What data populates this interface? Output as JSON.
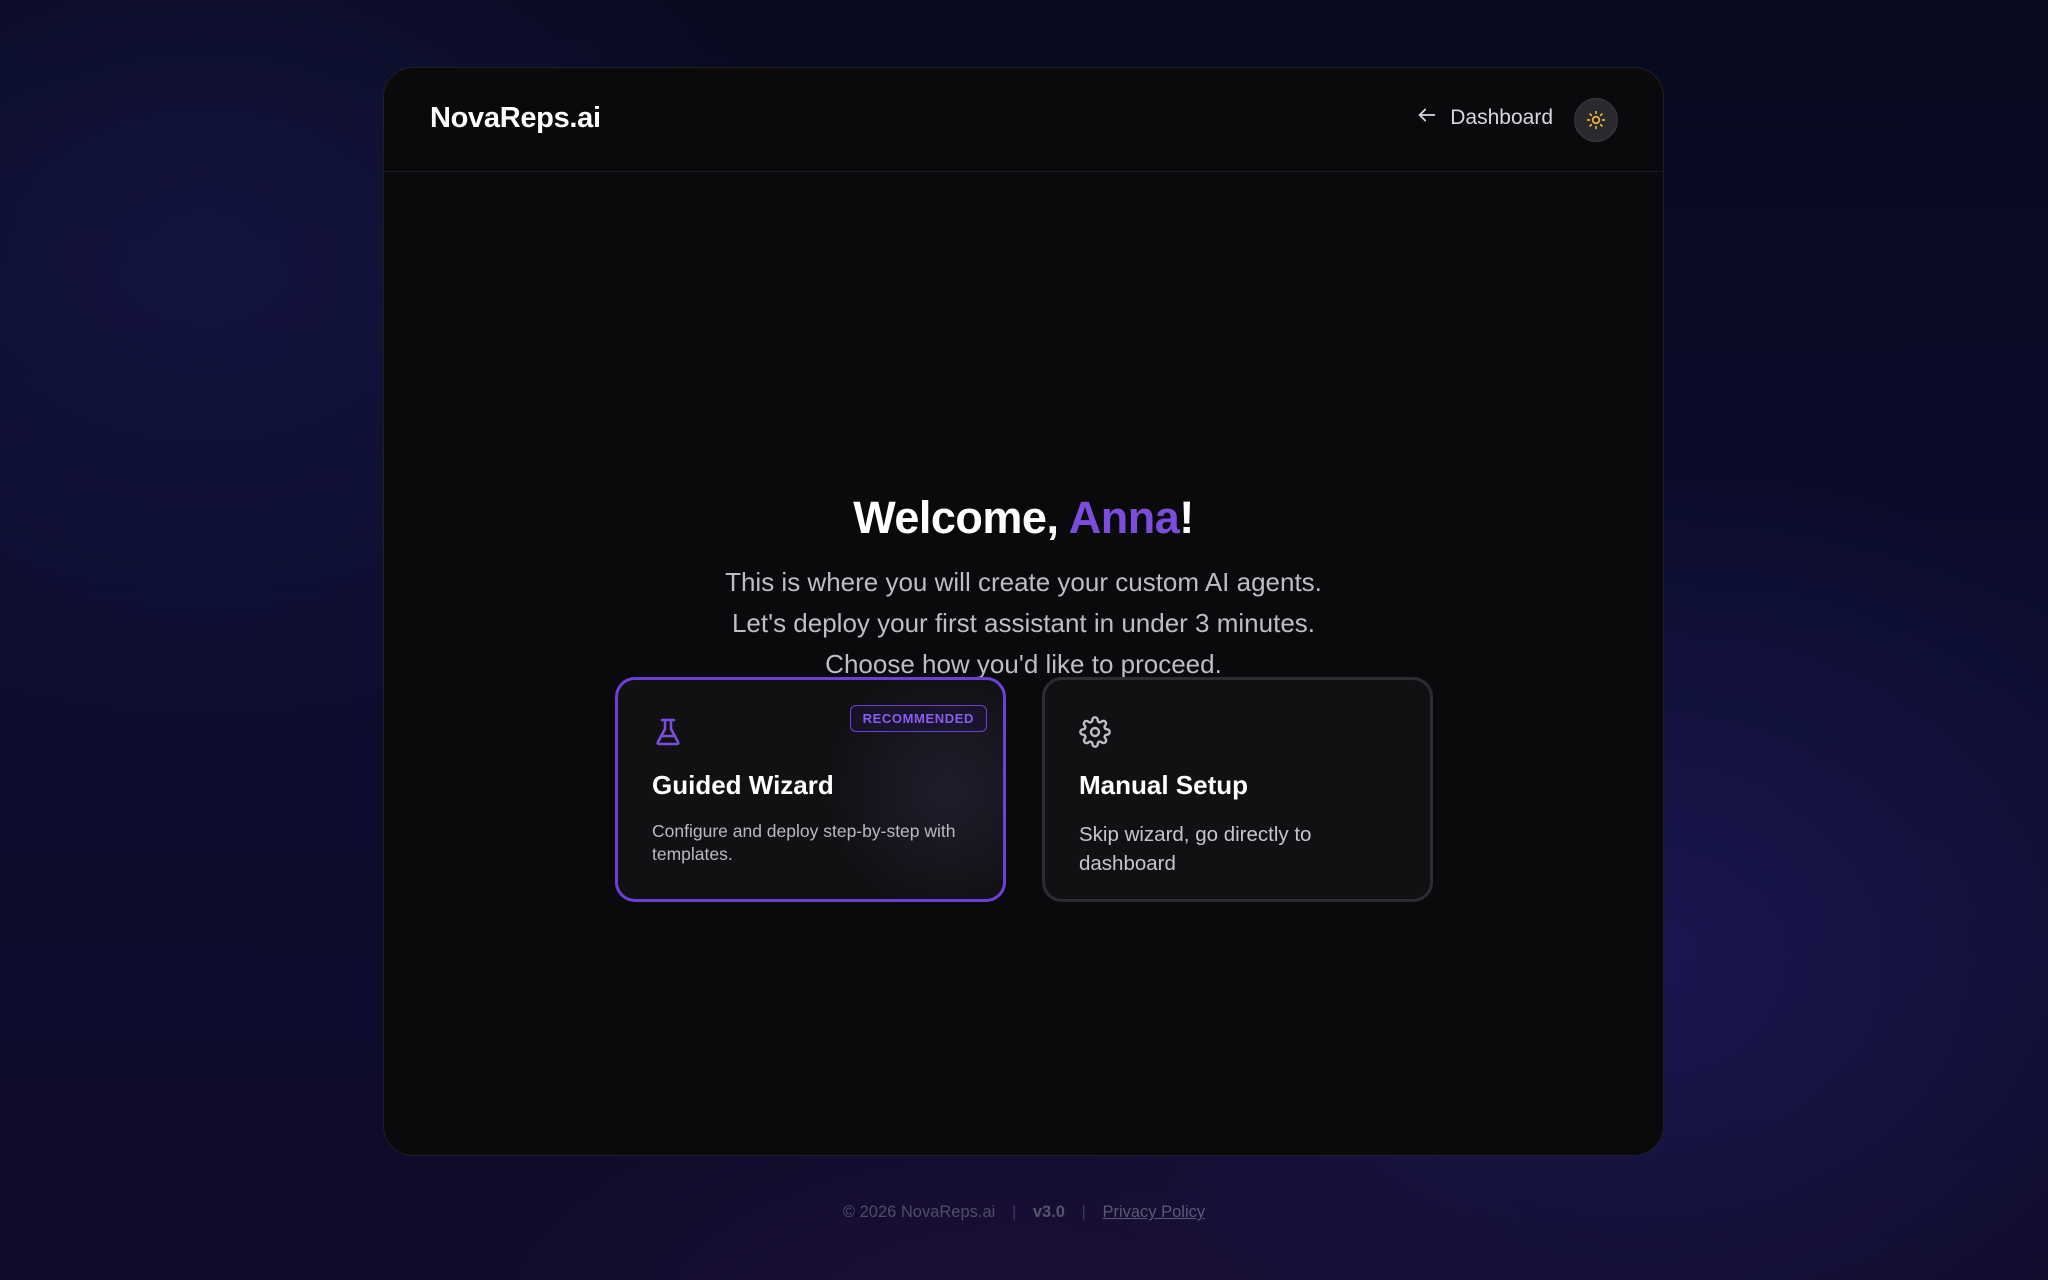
{
  "header": {
    "brand": "NovaReps.ai",
    "dashboard_label": "Dashboard",
    "back_icon": "arrow-left-icon",
    "theme_icon": "sun-icon"
  },
  "hero": {
    "greeting": "Welcome, ",
    "user_name": "Anna",
    "exclamation": "!",
    "subtitle_lines": [
      "This is where you will create your custom AI agents.",
      "Let's deploy your first assistant in under 3 minutes.",
      "Choose how you'd like to proceed."
    ]
  },
  "options": [
    {
      "title": "Guided Wizard",
      "description": "Configure and deploy step-by-step with templates.",
      "badge": "RECOMMENDED",
      "icon": "flask-icon",
      "selected": true
    },
    {
      "title": "Manual Setup",
      "description": "Skip wizard, go directly to dashboard",
      "icon": "gear-icon",
      "selected": false
    }
  ],
  "footer": {
    "copyright": "© 2026 NovaReps.ai",
    "version": "v3.0",
    "privacy": "Privacy Policy"
  },
  "colors": {
    "accent": "#7c4ddb",
    "card_border_selected": "#6c3fd9",
    "theme_icon": "#f5b73c"
  }
}
